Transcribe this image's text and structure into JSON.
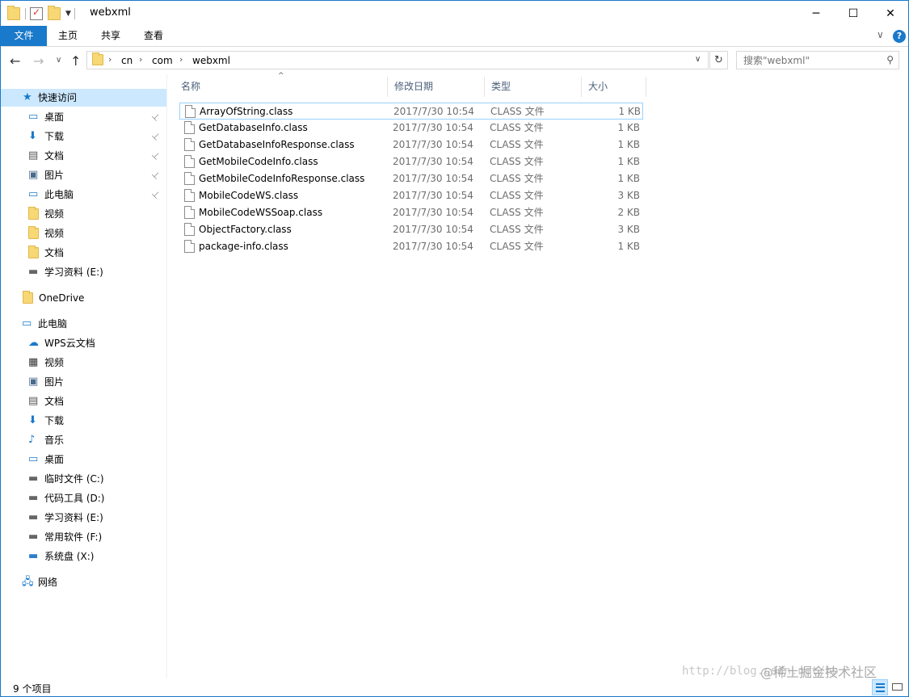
{
  "window": {
    "title": "webxml",
    "min_symbol": "─",
    "max_symbol": "☐",
    "close_symbol": "✕"
  },
  "ribbon": {
    "tabs": [
      "文件",
      "主页",
      "共享",
      "查看"
    ],
    "expand_symbol": "∨",
    "help_symbol": "?"
  },
  "nav": {
    "back_symbol": "←",
    "forward_symbol": "→",
    "recent_symbol": "∨",
    "up_symbol": "↑",
    "breadcrumbs": [
      "cn",
      "com",
      "webxml"
    ],
    "separator": "›",
    "dropdown_symbol": "∨",
    "refresh_symbol": "↻",
    "search_placeholder": "搜索\"webxml\"",
    "search_icon": "search-icon"
  },
  "sidebar": {
    "quick_access": {
      "label": "快速访问",
      "icon": "star-icon"
    },
    "quick_items": [
      {
        "label": "桌面",
        "icon": "desktop-icon",
        "pinned": true
      },
      {
        "label": "下载",
        "icon": "download-icon",
        "pinned": true
      },
      {
        "label": "文档",
        "icon": "document-icon",
        "pinned": true
      },
      {
        "label": "图片",
        "icon": "picture-icon",
        "pinned": true
      },
      {
        "label": "此电脑",
        "icon": "computer-icon",
        "pinned": true
      },
      {
        "label": "视频",
        "icon": "folder-icon",
        "pinned": false
      },
      {
        "label": "视频",
        "icon": "folder-icon",
        "pinned": false
      },
      {
        "label": "文档",
        "icon": "folder-icon",
        "pinned": false
      },
      {
        "label": "学习资料 (E:)",
        "icon": "drive-icon",
        "pinned": false
      }
    ],
    "onedrive": {
      "label": "OneDrive",
      "icon": "folder-icon"
    },
    "this_pc": {
      "label": "此电脑",
      "icon": "computer-icon"
    },
    "pc_items": [
      {
        "label": "WPS云文档",
        "icon": "cloud-icon"
      },
      {
        "label": "视频",
        "icon": "video-icon"
      },
      {
        "label": "图片",
        "icon": "picture-icon"
      },
      {
        "label": "文档",
        "icon": "document-icon"
      },
      {
        "label": "下载",
        "icon": "download-icon"
      },
      {
        "label": "音乐",
        "icon": "music-icon"
      },
      {
        "label": "桌面",
        "icon": "desktop-icon"
      },
      {
        "label": "临时文件 (C:)",
        "icon": "drive-icon"
      },
      {
        "label": "代码工具 (D:)",
        "icon": "drive-icon"
      },
      {
        "label": "学习资料 (E:)",
        "icon": "drive-icon"
      },
      {
        "label": "常用软件 (F:)",
        "icon": "drive-icon"
      },
      {
        "label": "系统盘 (X:)",
        "icon": "network-drive-icon"
      }
    ],
    "network": {
      "label": "网络",
      "icon": "network-icon"
    },
    "pin_symbol": "📌"
  },
  "columns": {
    "name": "名称",
    "date": "修改日期",
    "type": "类型",
    "size": "大小",
    "sort_symbol": "^"
  },
  "files": [
    {
      "name": "ArrayOfString.class",
      "date": "2017/7/30 10:54",
      "type": "CLASS 文件",
      "size": "1 KB"
    },
    {
      "name": "GetDatabaseInfo.class",
      "date": "2017/7/30 10:54",
      "type": "CLASS 文件",
      "size": "1 KB"
    },
    {
      "name": "GetDatabaseInfoResponse.class",
      "date": "2017/7/30 10:54",
      "type": "CLASS 文件",
      "size": "1 KB"
    },
    {
      "name": "GetMobileCodeInfo.class",
      "date": "2017/7/30 10:54",
      "type": "CLASS 文件",
      "size": "1 KB"
    },
    {
      "name": "GetMobileCodeInfoResponse.class",
      "date": "2017/7/30 10:54",
      "type": "CLASS 文件",
      "size": "1 KB"
    },
    {
      "name": "MobileCodeWS.class",
      "date": "2017/7/30 10:54",
      "type": "CLASS 文件",
      "size": "3 KB"
    },
    {
      "name": "MobileCodeWSSoap.class",
      "date": "2017/7/30 10:54",
      "type": "CLASS 文件",
      "size": "2 KB"
    },
    {
      "name": "ObjectFactory.class",
      "date": "2017/7/30 10:54",
      "type": "CLASS 文件",
      "size": "3 KB"
    },
    {
      "name": "package-info.class",
      "date": "2017/7/30 10:54",
      "type": "CLASS 文件",
      "size": "1 KB"
    }
  ],
  "status": {
    "item_count": "9 个项目"
  },
  "watermark": {
    "url": "http://blog.csdn.net/ho",
    "brand": "@稀土掘金技术社区"
  },
  "colors": {
    "accent": "#1979ca",
    "selected_bg": "#cce8ff",
    "header_text": "#4c607a",
    "secondary_text": "#6d6d6d"
  }
}
